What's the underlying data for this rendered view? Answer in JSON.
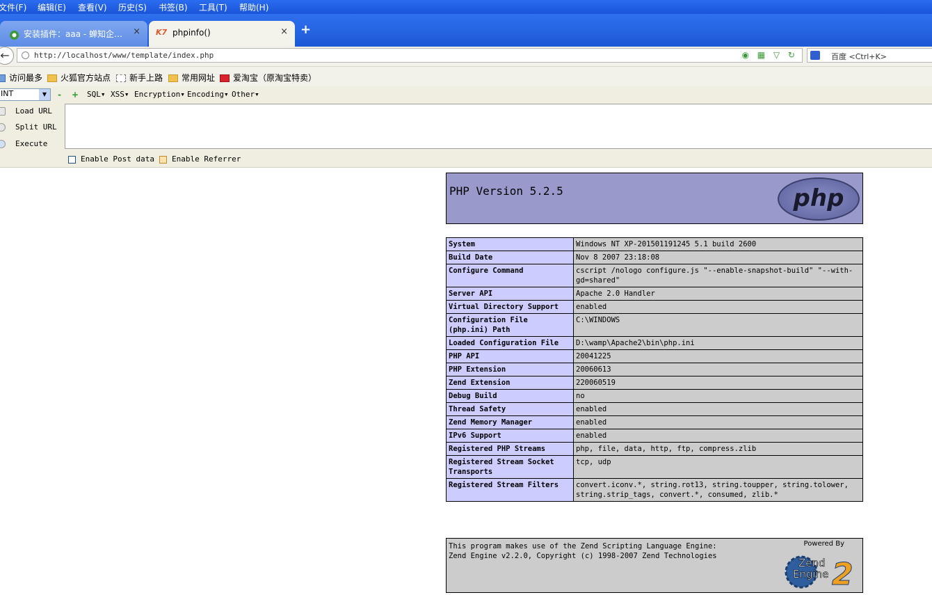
{
  "menu": [
    "文件(F)",
    "编辑(E)",
    "查看(V)",
    "历史(S)",
    "书签(B)",
    "工具(T)",
    "帮助(H)"
  ],
  "tabs": [
    {
      "label": "安装插件：aaa - 蝉知企…",
      "close": "×"
    },
    {
      "label": "phpinfo()",
      "close": "×"
    }
  ],
  "newtab": "+",
  "nav": {
    "back": "←",
    "url": "http://localhost/www/template/index.php",
    "url_icons": "◉ ▦ ▽ ↻",
    "search_placeholder": "百度 <Ctrl+K>"
  },
  "bookmarks": [
    "访问最多",
    "火狐官方站点",
    "新手上路",
    "常用网址",
    "爱淘宝（原淘宝特卖）"
  ],
  "hackbar": {
    "select_value": "INT",
    "minus": "-",
    "plus": "+",
    "menus": [
      "SQL▾",
      "XSS▾",
      "Encryption▾",
      "Encoding▾",
      "Other▾"
    ],
    "buttons": [
      "Load URL",
      "Split URL",
      "Execute"
    ],
    "enable_post": "Enable Post data",
    "enable_referrer": "Enable Referrer"
  },
  "phpinfo": {
    "version": "PHP Version 5.2.5",
    "logo": "php",
    "rows": [
      {
        "key": "System",
        "value": "Windows NT XP-201501191245 5.1 build 2600"
      },
      {
        "key": "Build Date",
        "value": "Nov 8 2007 23:18:08"
      },
      {
        "key": "Configure Command",
        "value": "cscript /nologo configure.js \"--enable-snapshot-build\" \"--with-gd=shared\""
      },
      {
        "key": "Server API",
        "value": "Apache 2.0 Handler"
      },
      {
        "key": "Virtual Directory Support",
        "value": "enabled"
      },
      {
        "key": "Configuration File (php.ini) Path",
        "value": "C:\\WINDOWS"
      },
      {
        "key": "Loaded Configuration File",
        "value": "D:\\wamp\\Apache2\\bin\\php.ini"
      },
      {
        "key": "PHP API",
        "value": "20041225"
      },
      {
        "key": "PHP Extension",
        "value": "20060613"
      },
      {
        "key": "Zend Extension",
        "value": "220060519"
      },
      {
        "key": "Debug Build",
        "value": "no"
      },
      {
        "key": "Thread Safety",
        "value": "enabled"
      },
      {
        "key": "Zend Memory Manager",
        "value": "enabled"
      },
      {
        "key": "IPv6 Support",
        "value": "enabled"
      },
      {
        "key": "Registered PHP Streams",
        "value": "php, file, data, http, ftp, compress.zlib"
      },
      {
        "key": "Registered Stream Socket Transports",
        "value": "tcp, udp"
      },
      {
        "key": "Registered Stream Filters",
        "value": "convert.iconv.*, string.rot13, string.toupper, string.tolower, string.strip_tags, convert.*, consumed, zlib.*"
      }
    ],
    "zend_text": "This program makes use of the Zend Scripting Language Engine:\nZend Engine v2.2.0, Copyright (c) 1998-2007 Zend Technologies",
    "powered_by": "Powered By",
    "zend_logo_line1": "Zend",
    "zend_logo_line2": "Engine",
    "zend_logo_num": "2"
  }
}
